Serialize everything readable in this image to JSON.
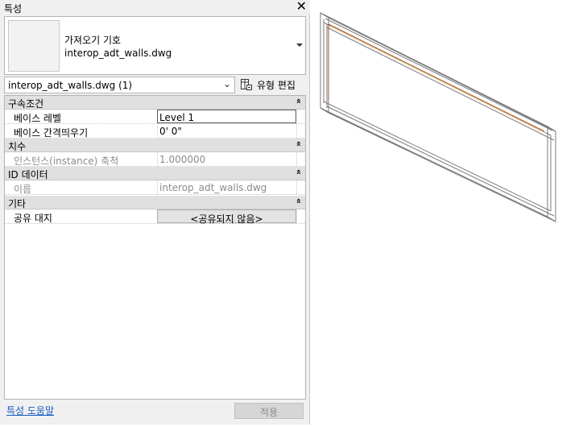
{
  "panel": {
    "title": "특성",
    "close_glyph": "✕"
  },
  "type_selector": {
    "family": "가져오기 기호",
    "type": "interop_adt_walls.dwg"
  },
  "instance_filter": {
    "value": "interop_adt_walls.dwg (1)",
    "chevron": "⌄"
  },
  "edit_type": {
    "label": "유형 편집",
    "icon": "edit-type-icon"
  },
  "groups": [
    {
      "label": "구속조건",
      "collapse": "»",
      "rows": [
        {
          "name": "베이스 레벨",
          "value": "Level 1"
        },
        {
          "name": "베이스 간격띄우기",
          "value": "0'  0\""
        }
      ]
    },
    {
      "label": "치수",
      "collapse": "»",
      "rows": [
        {
          "name": "인스턴스(instance) 축척",
          "value": "1.000000"
        }
      ]
    },
    {
      "label": "ID 데이터",
      "collapse": "»",
      "rows": [
        {
          "name": "이름",
          "value": "interop_adt_walls.dwg"
        }
      ]
    },
    {
      "label": "기타",
      "collapse": "»",
      "rows": [
        {
          "name": "공유 대지",
          "value": "<공유되지 않음>"
        }
      ]
    }
  ],
  "footer": {
    "help_link": "특성 도움말",
    "apply_label": "적용"
  },
  "colors": {
    "panel_bg": "#f0f0f0",
    "group_bg": "#e0e0e0",
    "link": "#1a5bc4",
    "wall_line": "#7a7a7a",
    "wall_accent": "#a0522d"
  }
}
